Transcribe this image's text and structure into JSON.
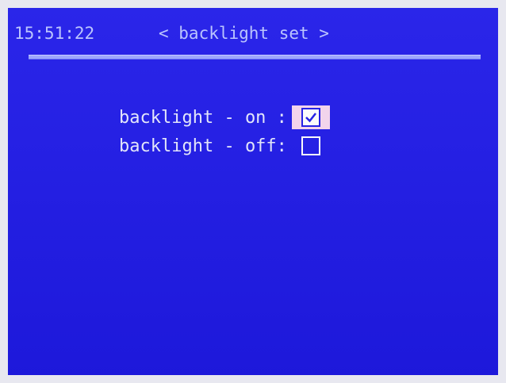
{
  "header": {
    "time": "15:51:22",
    "title": "< backlight set >"
  },
  "options": [
    {
      "label": "backlight - on :",
      "checked": true,
      "focused": true
    },
    {
      "label": "backlight - off:",
      "checked": false,
      "focused": false
    }
  ],
  "colors": {
    "background": "#1f1ae8",
    "text": "#e6e9ff",
    "focus_highlight": "#f6d6ef"
  },
  "icons": {
    "checked": "checkbox-checked-icon",
    "unchecked": "checkbox-empty-icon"
  }
}
